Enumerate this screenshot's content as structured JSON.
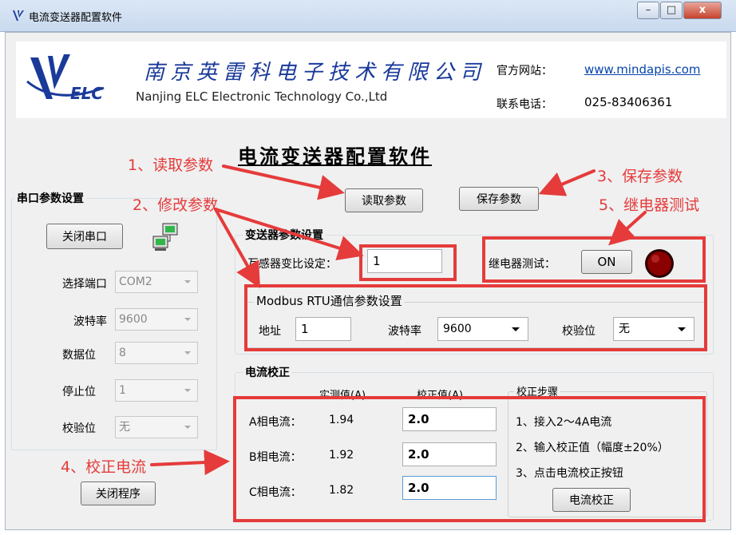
{
  "window": {
    "title": "电流变送器配置软件",
    "minimize": "–",
    "maximize": "□",
    "close": "x"
  },
  "header": {
    "company_cn": "南京英雷科电子技术有限公司",
    "company_en": "Nanjing ELC Electronic Technology Co.,Ltd",
    "logo_text": "ELC",
    "site_label": "官方网站：",
    "site_url": "www.mindapis.com",
    "phone_label": "联系电话：",
    "phone": "025-83406361"
  },
  "main_title": "电流变送器配置软件",
  "toolbar": {
    "read_label": "读取参数",
    "save_label": "保存参数"
  },
  "serial": {
    "title": "串口参数设置",
    "close_port_label": "关闭串口",
    "port_label": "选择端口",
    "port_value": "COM2",
    "baud_label": "波特率",
    "baud_value": "9600",
    "data_label": "数据位",
    "data_value": "8",
    "stop_label": "停止位",
    "stop_value": "1",
    "parity_label": "校验位",
    "parity_value": "无"
  },
  "close_program_label": "关闭程序",
  "transmitter": {
    "title": "变送器参数设置",
    "ct_label": "互感器变比设定：",
    "ct_value": "1",
    "relay_label": "继电器测试：",
    "relay_button": "ON",
    "modbus": {
      "title": "Modbus RTU通信参数设置",
      "addr_label": "地址",
      "addr_value": "1",
      "baud_label": "波特率",
      "baud_value": "9600",
      "parity_label": "校验位",
      "parity_value": "无"
    }
  },
  "calibration": {
    "title": "电流校正",
    "measured_header": "实测值(A)",
    "calib_header": "校正值(A)",
    "rows": [
      {
        "label": "A相电流：",
        "measured": "1.94",
        "calib": "2.0"
      },
      {
        "label": "B相电流：",
        "measured": "1.92",
        "calib": "2.0"
      },
      {
        "label": "C相电流：",
        "measured": "1.82",
        "calib": "2.0"
      }
    ],
    "steps_title": "校正步骤",
    "steps": [
      "1、接入2～4A电流",
      "2、输入校正值（幅度±20%）",
      "3、点击电流校正按钮"
    ],
    "button_label": "电流校正"
  },
  "annotations": {
    "step1": "1、读取参数",
    "step2": "2、修改参数",
    "step3": "3、保存参数",
    "step4": "4、校正电流",
    "step5": "5、继电器测试",
    "color": "#e53b3b"
  },
  "colors": {
    "accent_blue": "#1a3a9a",
    "link": "#0645ad",
    "relay_led": "#8b0000"
  }
}
